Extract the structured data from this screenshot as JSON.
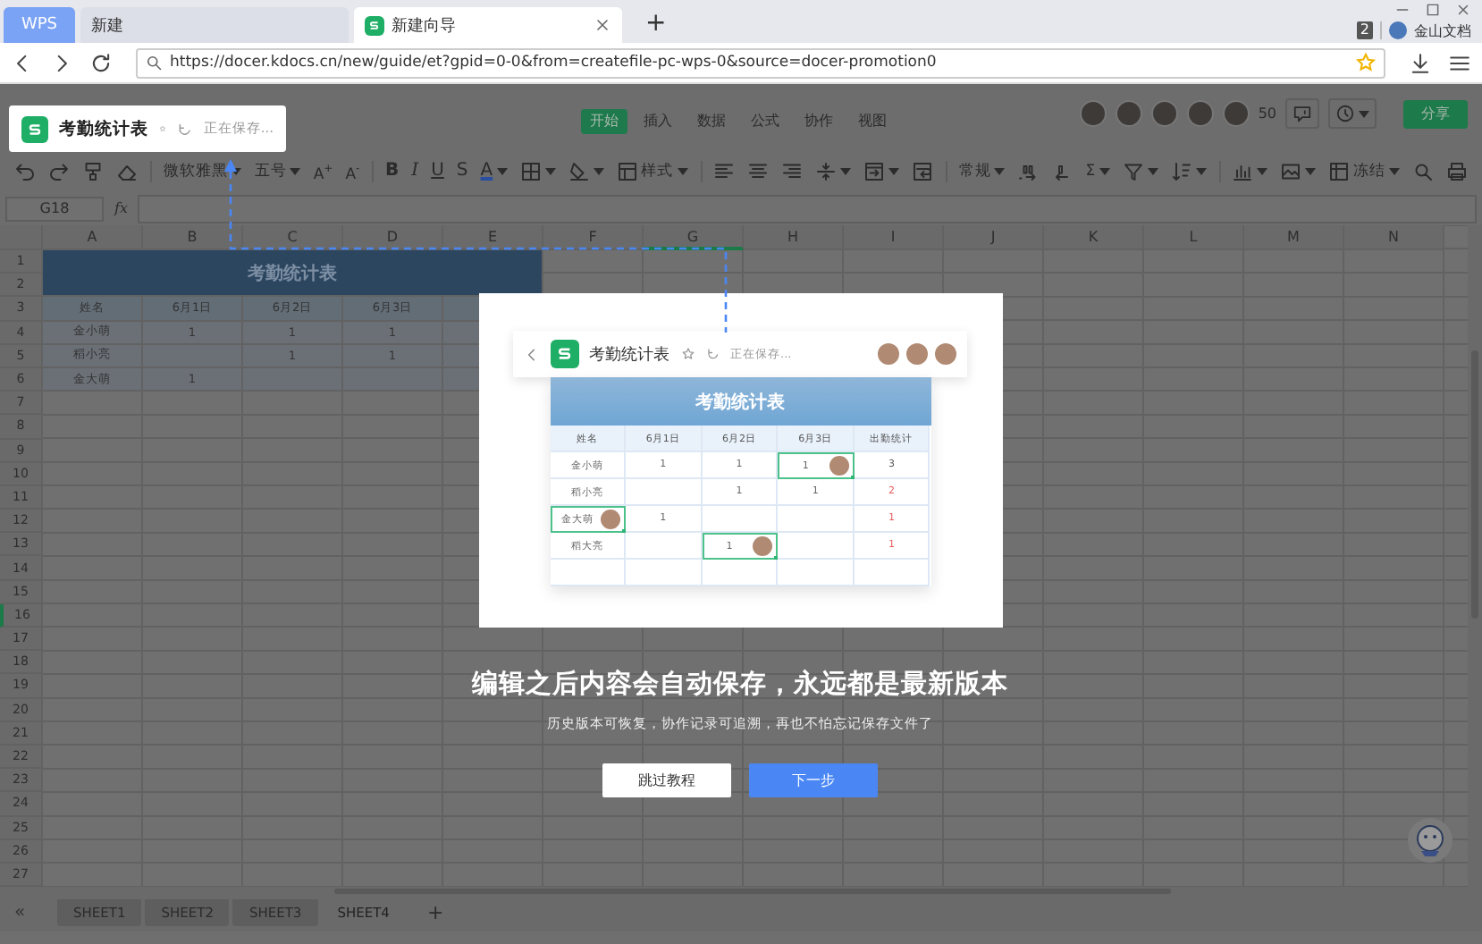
{
  "browser": {
    "tabs": [
      {
        "label": "WPS",
        "kind": "brand",
        "selected": false
      },
      {
        "label": "新建",
        "kind": "page",
        "selected": false
      },
      {
        "label": "新建向导",
        "kind": "page",
        "selected": true
      }
    ],
    "new_tab": "+",
    "badge": "2",
    "account": "金山文档",
    "url": "https://docer.kdocs.cn/new/guide/et?gpid=0-0&from=createfile-pc-wps-0&source=docer-promotion0"
  },
  "topbar": {
    "doc_title": "考勤统计表",
    "doc_status": "正在保存...",
    "menu": [
      {
        "label": "开始",
        "selected": true
      },
      {
        "label": "插入",
        "selected": false
      },
      {
        "label": "数据",
        "selected": false
      },
      {
        "label": "公式",
        "selected": false
      },
      {
        "label": "协作",
        "selected": false
      },
      {
        "label": "视图",
        "selected": false
      }
    ],
    "online_count": "50",
    "share": "分享"
  },
  "toolbar": {
    "labels": [
      "微软雅黑",
      "五号",
      "A$^{+}$",
      "A$^{-}$",
      "B",
      "I",
      "U",
      "S",
      "A",
      "样式",
      "常规",
      "Σ",
      "冻结"
    ]
  },
  "formula_bar": {
    "cell": "G18",
    "function_label": "fx"
  },
  "grid": {
    "columns": [
      {
        "label": "A",
        "selected": false
      },
      {
        "label": "B",
        "selected": false
      },
      {
        "label": "C",
        "selected": false
      },
      {
        "label": "D",
        "selected": false
      },
      {
        "label": "E",
        "selected": false
      },
      {
        "label": "F",
        "selected": false
      },
      {
        "label": "G",
        "selected": true
      },
      {
        "label": "H",
        "selected": false
      },
      {
        "label": "I",
        "selected": false
      },
      {
        "label": "J",
        "selected": false
      },
      {
        "label": "K",
        "selected": false
      },
      {
        "label": "L",
        "selected": false
      },
      {
        "label": "M",
        "selected": false
      },
      {
        "label": "N",
        "selected": false
      }
    ],
    "title": "考勤统计表",
    "rows": [
      {
        "label": "1",
        "selected": false
      },
      {
        "label": "2",
        "selected": false
      },
      {
        "label": "3",
        "selected": false,
        "kind": "header",
        "cells": [
          "姓名",
          "6月1日",
          "6月2日",
          "6月3日"
        ]
      },
      {
        "label": "4",
        "selected": false,
        "kind": "data",
        "cells": [
          "金小萌",
          "1",
          "1",
          "1"
        ]
      },
      {
        "label": "5",
        "selected": false,
        "kind": "data",
        "cells": [
          "稻小亮",
          null,
          "1",
          "1"
        ]
      },
      {
        "label": "6",
        "selected": false,
        "kind": "data",
        "cells": [
          "金大萌",
          "1",
          null,
          null
        ]
      },
      {
        "label": "7",
        "selected": false
      },
      {
        "label": "8",
        "selected": false
      },
      {
        "label": "9",
        "selected": false
      },
      {
        "label": "10",
        "selected": false
      },
      {
        "label": "11",
        "selected": false
      },
      {
        "label": "12",
        "selected": false
      },
      {
        "label": "13",
        "selected": false
      },
      {
        "label": "14",
        "selected": false
      },
      {
        "label": "15",
        "selected": false
      },
      {
        "label": "16",
        "selected": true
      },
      {
        "label": "17",
        "selected": false
      },
      {
        "label": "18",
        "selected": false
      },
      {
        "label": "19",
        "selected": false
      },
      {
        "label": "20",
        "selected": false
      },
      {
        "label": "21",
        "selected": false
      },
      {
        "label": "22",
        "selected": false
      },
      {
        "label": "23",
        "selected": false
      },
      {
        "label": "24",
        "selected": false
      },
      {
        "label": "25",
        "selected": false
      },
      {
        "label": "26",
        "selected": false
      },
      {
        "label": "27",
        "selected": false
      }
    ]
  },
  "guide": {
    "preview": {
      "doc_title": "考勤统计表",
      "doc_status": "正在保存...",
      "table_title": "考勤统计表",
      "columns": [
        "姓名",
        "6月1日",
        "6月2日",
        "6月3日",
        "出勤统计"
      ],
      "rows": [
        {
          "cells": [
            {
              "text": "金小萌",
              "editing": false
            },
            {
              "text": "1",
              "editing": false
            },
            {
              "text": "1",
              "editing": false
            },
            {
              "text": "1",
              "editing": true
            },
            {
              "text": "3",
              "editing": false,
              "color": "#555555"
            }
          ]
        },
        {
          "cells": [
            {
              "text": "稻小亮",
              "editing": false
            },
            null,
            {
              "text": "1",
              "editing": false
            },
            {
              "text": "1",
              "editing": false
            },
            {
              "text": "2",
              "editing": false,
              "color": "#e85a5a"
            }
          ]
        },
        {
          "cells": [
            {
              "text": "金大萌",
              "editing": true
            },
            {
              "text": "1",
              "editing": false
            },
            null,
            null,
            {
              "text": "1",
              "editing": false,
              "color": "#e85a5a"
            }
          ]
        },
        {
          "cells": [
            {
              "text": "稻大亮",
              "editing": false
            },
            null,
            {
              "text": "1",
              "editing": true
            },
            null,
            {
              "text": "1",
              "editing": false,
              "color": "#e85a5a"
            }
          ]
        },
        {
          "cells": [
            null,
            null,
            null,
            null,
            null
          ]
        }
      ]
    },
    "heading": "编辑之后内容会自动保存，永远都是最新版本",
    "subtitle": "历史版本可恢复，协作记录可追溯，再也不怕忘记保存文件了",
    "buttons": [
      {
        "label": "跳过教程",
        "kind": "secondary"
      },
      {
        "label": "下一步",
        "kind": "primary"
      }
    ]
  },
  "sheet_tabs": {
    "first": "«",
    "tabs": [
      {
        "label": "SHEET1",
        "selected": false
      },
      {
        "label": "SHEET2",
        "selected": false
      },
      {
        "label": "SHEET3",
        "selected": false
      },
      {
        "label": "SHEET4",
        "selected": true
      }
    ],
    "add": "+"
  }
}
